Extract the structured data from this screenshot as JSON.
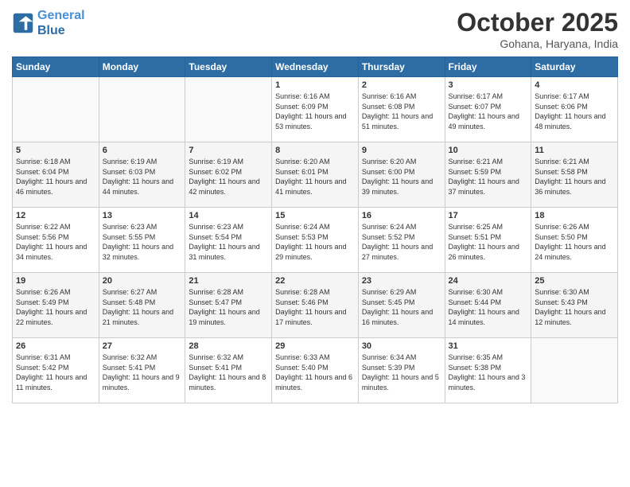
{
  "header": {
    "logo_line1": "General",
    "logo_line2": "Blue",
    "month": "October 2025",
    "location": "Gohana, Haryana, India"
  },
  "weekdays": [
    "Sunday",
    "Monday",
    "Tuesday",
    "Wednesday",
    "Thursday",
    "Friday",
    "Saturday"
  ],
  "weeks": [
    [
      {
        "day": "",
        "info": ""
      },
      {
        "day": "",
        "info": ""
      },
      {
        "day": "",
        "info": ""
      },
      {
        "day": "1",
        "info": "Sunrise: 6:16 AM\nSunset: 6:09 PM\nDaylight: 11 hours and 53 minutes."
      },
      {
        "day": "2",
        "info": "Sunrise: 6:16 AM\nSunset: 6:08 PM\nDaylight: 11 hours and 51 minutes."
      },
      {
        "day": "3",
        "info": "Sunrise: 6:17 AM\nSunset: 6:07 PM\nDaylight: 11 hours and 49 minutes."
      },
      {
        "day": "4",
        "info": "Sunrise: 6:17 AM\nSunset: 6:06 PM\nDaylight: 11 hours and 48 minutes."
      }
    ],
    [
      {
        "day": "5",
        "info": "Sunrise: 6:18 AM\nSunset: 6:04 PM\nDaylight: 11 hours and 46 minutes."
      },
      {
        "day": "6",
        "info": "Sunrise: 6:19 AM\nSunset: 6:03 PM\nDaylight: 11 hours and 44 minutes."
      },
      {
        "day": "7",
        "info": "Sunrise: 6:19 AM\nSunset: 6:02 PM\nDaylight: 11 hours and 42 minutes."
      },
      {
        "day": "8",
        "info": "Sunrise: 6:20 AM\nSunset: 6:01 PM\nDaylight: 11 hours and 41 minutes."
      },
      {
        "day": "9",
        "info": "Sunrise: 6:20 AM\nSunset: 6:00 PM\nDaylight: 11 hours and 39 minutes."
      },
      {
        "day": "10",
        "info": "Sunrise: 6:21 AM\nSunset: 5:59 PM\nDaylight: 11 hours and 37 minutes."
      },
      {
        "day": "11",
        "info": "Sunrise: 6:21 AM\nSunset: 5:58 PM\nDaylight: 11 hours and 36 minutes."
      }
    ],
    [
      {
        "day": "12",
        "info": "Sunrise: 6:22 AM\nSunset: 5:56 PM\nDaylight: 11 hours and 34 minutes."
      },
      {
        "day": "13",
        "info": "Sunrise: 6:23 AM\nSunset: 5:55 PM\nDaylight: 11 hours and 32 minutes."
      },
      {
        "day": "14",
        "info": "Sunrise: 6:23 AM\nSunset: 5:54 PM\nDaylight: 11 hours and 31 minutes."
      },
      {
        "day": "15",
        "info": "Sunrise: 6:24 AM\nSunset: 5:53 PM\nDaylight: 11 hours and 29 minutes."
      },
      {
        "day": "16",
        "info": "Sunrise: 6:24 AM\nSunset: 5:52 PM\nDaylight: 11 hours and 27 minutes."
      },
      {
        "day": "17",
        "info": "Sunrise: 6:25 AM\nSunset: 5:51 PM\nDaylight: 11 hours and 26 minutes."
      },
      {
        "day": "18",
        "info": "Sunrise: 6:26 AM\nSunset: 5:50 PM\nDaylight: 11 hours and 24 minutes."
      }
    ],
    [
      {
        "day": "19",
        "info": "Sunrise: 6:26 AM\nSunset: 5:49 PM\nDaylight: 11 hours and 22 minutes."
      },
      {
        "day": "20",
        "info": "Sunrise: 6:27 AM\nSunset: 5:48 PM\nDaylight: 11 hours and 21 minutes."
      },
      {
        "day": "21",
        "info": "Sunrise: 6:28 AM\nSunset: 5:47 PM\nDaylight: 11 hours and 19 minutes."
      },
      {
        "day": "22",
        "info": "Sunrise: 6:28 AM\nSunset: 5:46 PM\nDaylight: 11 hours and 17 minutes."
      },
      {
        "day": "23",
        "info": "Sunrise: 6:29 AM\nSunset: 5:45 PM\nDaylight: 11 hours and 16 minutes."
      },
      {
        "day": "24",
        "info": "Sunrise: 6:30 AM\nSunset: 5:44 PM\nDaylight: 11 hours and 14 minutes."
      },
      {
        "day": "25",
        "info": "Sunrise: 6:30 AM\nSunset: 5:43 PM\nDaylight: 11 hours and 12 minutes."
      }
    ],
    [
      {
        "day": "26",
        "info": "Sunrise: 6:31 AM\nSunset: 5:42 PM\nDaylight: 11 hours and 11 minutes."
      },
      {
        "day": "27",
        "info": "Sunrise: 6:32 AM\nSunset: 5:41 PM\nDaylight: 11 hours and 9 minutes."
      },
      {
        "day": "28",
        "info": "Sunrise: 6:32 AM\nSunset: 5:41 PM\nDaylight: 11 hours and 8 minutes."
      },
      {
        "day": "29",
        "info": "Sunrise: 6:33 AM\nSunset: 5:40 PM\nDaylight: 11 hours and 6 minutes."
      },
      {
        "day": "30",
        "info": "Sunrise: 6:34 AM\nSunset: 5:39 PM\nDaylight: 11 hours and 5 minutes."
      },
      {
        "day": "31",
        "info": "Sunrise: 6:35 AM\nSunset: 5:38 PM\nDaylight: 11 hours and 3 minutes."
      },
      {
        "day": "",
        "info": ""
      }
    ]
  ]
}
